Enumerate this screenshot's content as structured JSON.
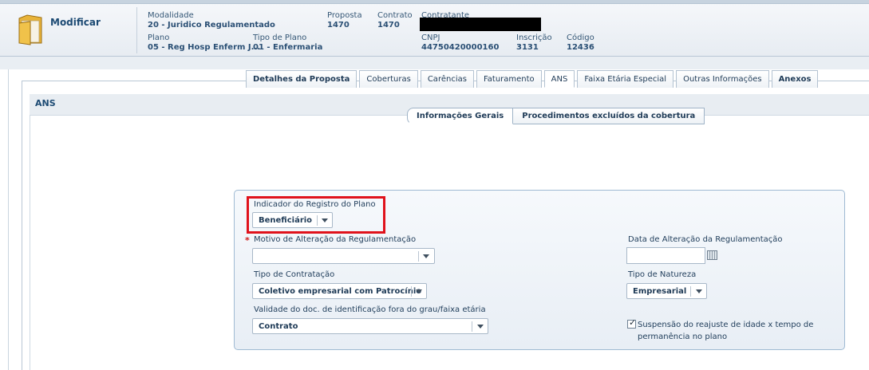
{
  "header": {
    "title": "Modificar",
    "modalidade": {
      "label": "Modalidade",
      "value": "20 - Juridico Regulamentado"
    },
    "proposta": {
      "label": "Proposta",
      "value": "1470"
    },
    "contrato": {
      "label": "Contrato",
      "value": "1470"
    },
    "contratante": {
      "label": "Contratante"
    },
    "plano": {
      "label": "Plano",
      "value": "05 - Reg Hosp Enferm J..."
    },
    "tipo_plano": {
      "label": "Tipo de Plano",
      "value": "01 - Enfermaria"
    },
    "cnpj": {
      "label": "CNPJ",
      "value": "44750420000160"
    },
    "inscricao": {
      "label": "Inscrição",
      "value": "3131"
    },
    "codigo": {
      "label": "Código",
      "value": "12436"
    }
  },
  "tabs": [
    {
      "label": "Detalhes da Proposta"
    },
    {
      "label": "Coberturas"
    },
    {
      "label": "Carências"
    },
    {
      "label": "Faturamento"
    },
    {
      "label": "ANS"
    },
    {
      "label": "Faixa Etária Especial"
    },
    {
      "label": "Outras Informações"
    },
    {
      "label": "Anexos"
    }
  ],
  "section": {
    "title": "ANS"
  },
  "subtabs": [
    {
      "label": "Informações Gerais"
    },
    {
      "label": "Procedimentos excluídos da cobertura"
    }
  ],
  "form": {
    "indicador": {
      "label": "Indicador do Registro do Plano",
      "value": "Beneficiário"
    },
    "motivo": {
      "label": "Motivo de Alteração da Regulamentação",
      "value": ""
    },
    "data_alteracao": {
      "label": "Data de Alteração da Regulamentação",
      "value": ""
    },
    "tipo_contratacao": {
      "label": "Tipo de Contratação",
      "value": "Coletivo empresarial com Patrocínio"
    },
    "tipo_natureza": {
      "label": "Tipo de Natureza",
      "value": "Empresarial"
    },
    "validade": {
      "label": "Validade do doc. de identificação fora do grau/faixa etária",
      "value": "Contrato"
    },
    "suspensao": {
      "label": "Suspensão do reajuste de idade x tempo de permanência no plano",
      "checked": true,
      "check_glyph": "✓"
    },
    "required_mark": "*"
  },
  "colors": {
    "highlight": "#e0121b",
    "accent": "#1c4a73",
    "required": "#d01919"
  }
}
